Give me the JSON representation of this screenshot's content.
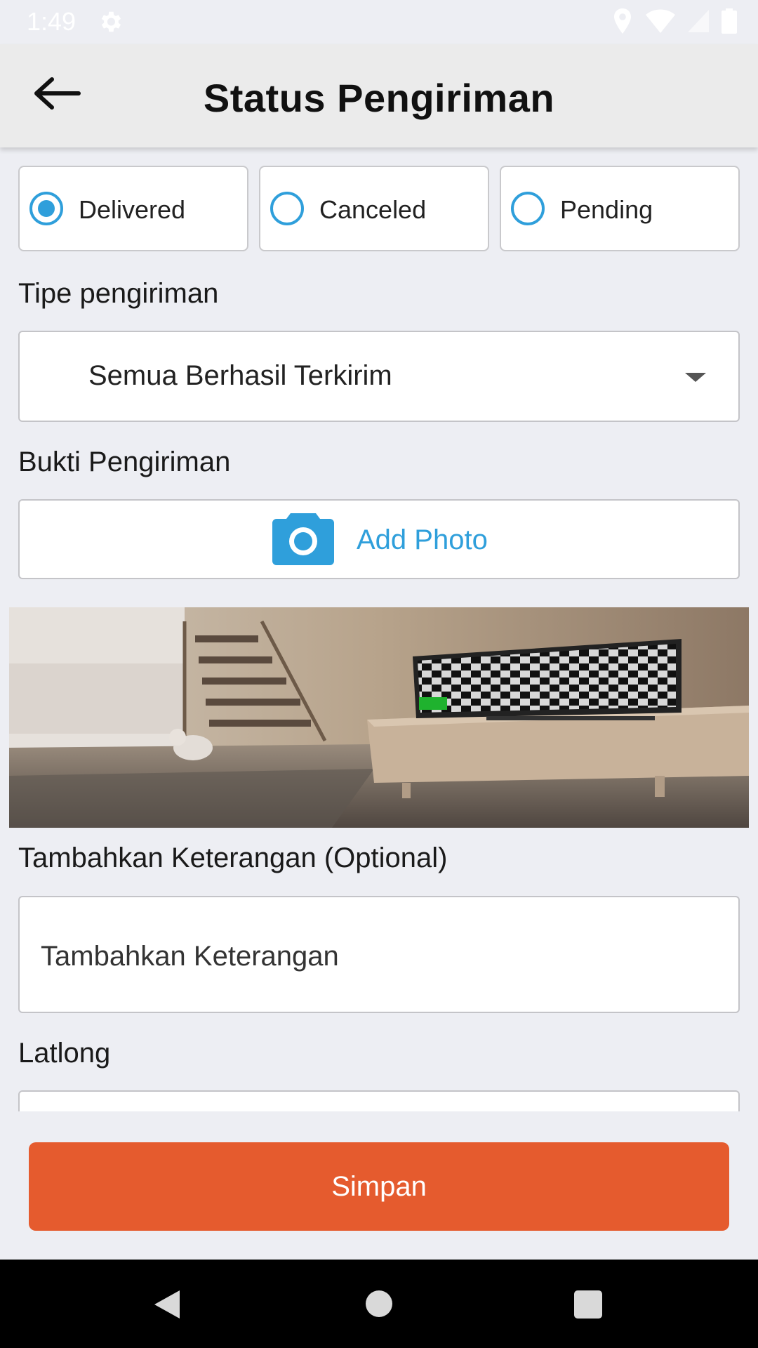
{
  "status_bar": {
    "time": "1:49",
    "icons": [
      "gear-icon",
      "location-icon",
      "wifi-icon",
      "signal-icon",
      "battery-icon"
    ]
  },
  "toolbar": {
    "back_icon": "arrow-left-icon",
    "title": "Status Pengiriman"
  },
  "status_options": [
    {
      "label": "Delivered",
      "selected": true
    },
    {
      "label": "Canceled",
      "selected": false
    },
    {
      "label": "Pending",
      "selected": false
    }
  ],
  "delivery_type": {
    "label": "Tipe pengiriman",
    "value": "Semua Berhasil Terkirim"
  },
  "proof": {
    "label": "Bukti Pengiriman",
    "add_photo_label": "Add Photo"
  },
  "notes": {
    "label": "Tambahkan Keterangan (Optional)",
    "placeholder": "Tambahkan Keterangan"
  },
  "latlong": {
    "label": "Latlong"
  },
  "save_button": {
    "label": "Simpan"
  },
  "colors": {
    "accent": "#2f9fdb",
    "primary_button": "#e55b2e",
    "background": "#edeef3"
  }
}
